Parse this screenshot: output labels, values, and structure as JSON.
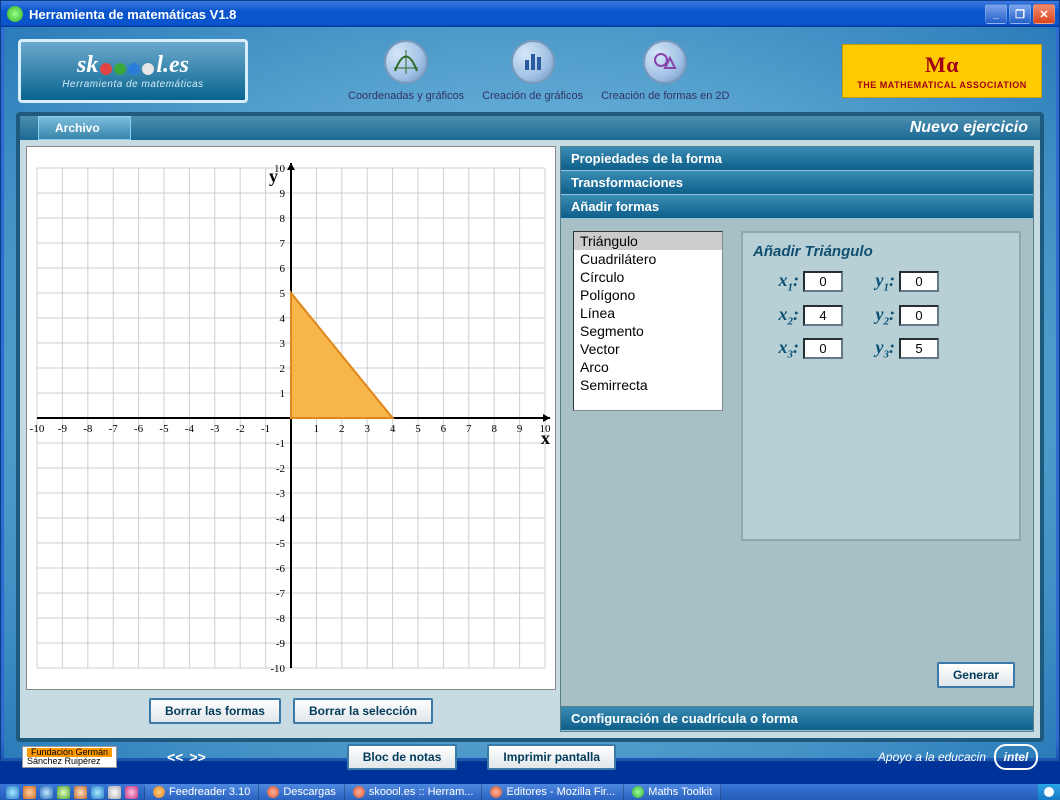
{
  "window": {
    "title": "Herramienta de matemáticas V1.8",
    "min": "_",
    "restore": "❐",
    "close": "✕"
  },
  "brand": {
    "name_pre": "sk",
    "name_post": "l",
    "domain": ".es",
    "subtitle": "Herramienta de matemáticas"
  },
  "header_icons": {
    "coords": "Coordenadas y gráficos",
    "charts": "Creación de gráficos",
    "shapes2d": "Creación de formas en 2D"
  },
  "ma_badge": {
    "symbol": "Mα",
    "text": "THE MATHEMATICAL ASSOCIATION"
  },
  "menubar": {
    "file": "Archivo",
    "new_exercise": "Nuevo ejercicio"
  },
  "accordion": {
    "props": "Propiedades de la forma",
    "trans": "Transformaciones",
    "add": "Añadir formas",
    "config": "Configuración de cuadrícula o forma"
  },
  "shape_list": [
    "Triángulo",
    "Cuadrilátero",
    "Círculo",
    "Polígono",
    "Línea",
    "Segmento",
    "Vector",
    "Arco",
    "Semirrecta"
  ],
  "shape_selected": 0,
  "add_panel": {
    "title": "Añadir Triángulo",
    "x1_label": "x1:",
    "y1_label": "y1:",
    "x2_label": "x2:",
    "y2_label": "y2:",
    "x3_label": "x3:",
    "y3_label": "y3:",
    "x1": "0",
    "y1": "0",
    "x2": "4",
    "y2": "0",
    "x3": "0",
    "y3": "5",
    "generate": "Generar"
  },
  "canvas_buttons": {
    "clear_shapes": "Borrar las formas",
    "clear_sel": "Borrar la selección"
  },
  "footer": {
    "sponsor_top": "Fundación  Germán",
    "sponsor_bot": "Sánchez Ruipérez",
    "notes": "Bloc de notas",
    "print": "Imprimir pantalla",
    "edu": "Apoyo a la educacin",
    "intel": "intel",
    "prev": "<<",
    "next": ">>"
  },
  "taskbar": {
    "items": [
      "Feedreader 3.10",
      "Descargas",
      "skoool.es :: Herram...",
      "Editores - Mozilla Fir...",
      "Maths Toolkit"
    ]
  },
  "chart_data": {
    "type": "scatter",
    "title": "",
    "xlabel": "x",
    "ylabel": "y",
    "xlim": [
      -10,
      10
    ],
    "ylim": [
      -10,
      10
    ],
    "xticks": [
      -10,
      -9,
      -8,
      -7,
      -6,
      -5,
      -4,
      -3,
      -2,
      -1,
      1,
      2,
      3,
      4,
      5,
      6,
      7,
      8,
      9,
      10
    ],
    "yticks": [
      -10,
      -9,
      -8,
      -7,
      -6,
      -5,
      -4,
      -3,
      -2,
      -1,
      1,
      2,
      3,
      4,
      5,
      6,
      7,
      8,
      9,
      10
    ],
    "grid": true,
    "shapes": [
      {
        "type": "polygon",
        "name": "triangle",
        "fill": "#f6b649",
        "stroke": "#e0861a",
        "points": [
          [
            0,
            0
          ],
          [
            4,
            0
          ],
          [
            0,
            5
          ]
        ]
      }
    ]
  }
}
